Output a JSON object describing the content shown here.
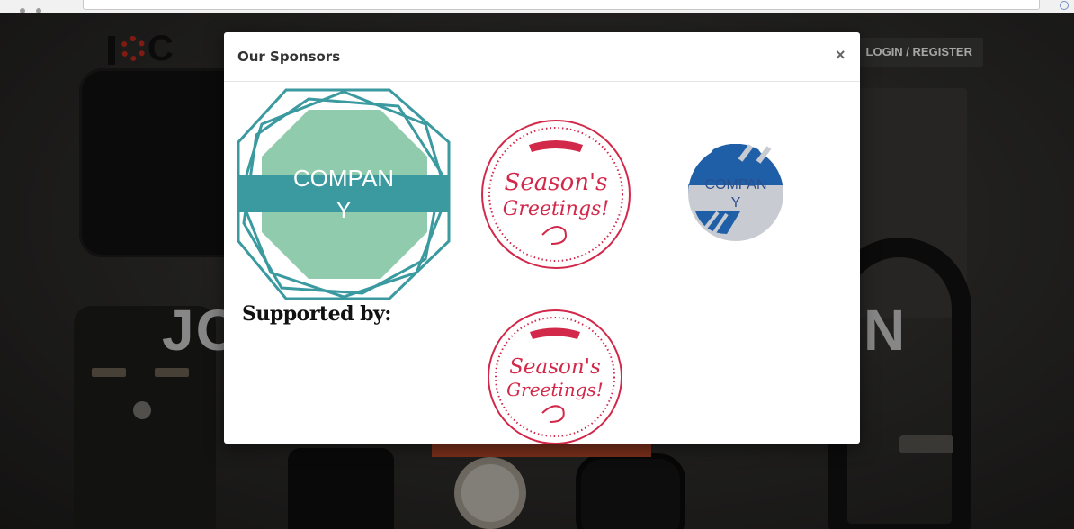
{
  "app": {
    "logo_text": "IOC",
    "login_label": "LOGIN / REGISTER",
    "hero_left_fragment": "JO",
    "hero_right_fragment": "N"
  },
  "modal": {
    "title": "Our Sponsors",
    "close_label": "×",
    "supported_by_label": "Supported by:",
    "sponsors": [
      {
        "line1": "COMPAN",
        "line2": "Y"
      },
      {
        "line1": "Season's",
        "line2": "Greetings!"
      },
      {
        "line1": "COMPAN",
        "line2": "Y"
      }
    ],
    "supporters": [
      {
        "line1": "Season's",
        "line2": "Greetings!"
      }
    ]
  },
  "colors": {
    "company_teal": "#3a9aa0",
    "company_green": "#8fcbac",
    "seasons_red": "#d2284a",
    "company2_blue": "#1f5fa8",
    "company2_grey": "#c8cbd1"
  }
}
